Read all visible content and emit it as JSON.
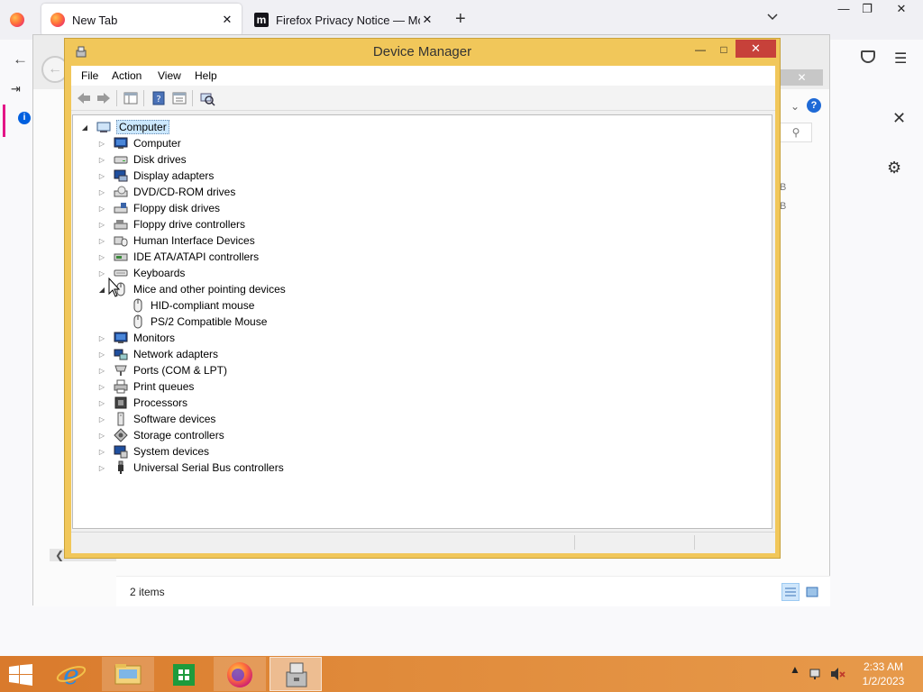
{
  "firefox": {
    "tabs": [
      {
        "label": "New Tab",
        "close": "✕"
      },
      {
        "label": "Firefox Privacy Notice — Mozilla",
        "close": "✕"
      }
    ],
    "new_tab_symbol": "+",
    "window_controls": {
      "minimize": "—",
      "restore": "❐",
      "close": "✕"
    },
    "back_symbol": "←",
    "menu_symbol": "☰",
    "notice_close_symbol": "✕",
    "gear_symbol": "⚙"
  },
  "background_window": {
    "close_symbol": "✕",
    "help_symbol": "?",
    "search_symbol": "⚲",
    "size_fragments": [
      "B",
      "B"
    ],
    "status_text": "2 items",
    "scroll_left_symbol": "❮"
  },
  "device_manager": {
    "title": "Device Manager",
    "window_controls": {
      "minimize": "—",
      "maximize": "□",
      "close": "✕"
    },
    "menu": [
      "File",
      "Action",
      "View",
      "Help"
    ],
    "root": {
      "label": "Computer",
      "expanded": true
    },
    "categories": [
      {
        "label": "Computer",
        "icon": "monitor-icon",
        "expanded": false
      },
      {
        "label": "Disk drives",
        "icon": "disk-drive-icon",
        "expanded": false
      },
      {
        "label": "Display adapters",
        "icon": "display-adapter-icon",
        "expanded": false
      },
      {
        "label": "DVD/CD-ROM drives",
        "icon": "dvd-drive-icon",
        "expanded": false
      },
      {
        "label": "Floppy disk drives",
        "icon": "floppy-drive-icon",
        "expanded": false
      },
      {
        "label": "Floppy drive controllers",
        "icon": "floppy-controller-icon",
        "expanded": false
      },
      {
        "label": "Human Interface Devices",
        "icon": "hid-icon",
        "expanded": false
      },
      {
        "label": "IDE ATA/ATAPI controllers",
        "icon": "ide-controller-icon",
        "expanded": false
      },
      {
        "label": "Keyboards",
        "icon": "keyboard-icon",
        "expanded": false
      },
      {
        "label": "Mice and other pointing devices",
        "icon": "mouse-icon",
        "expanded": true,
        "children": [
          "HID-compliant mouse",
          "PS/2 Compatible Mouse"
        ]
      },
      {
        "label": "Monitors",
        "icon": "monitor-icon",
        "expanded": false
      },
      {
        "label": "Network adapters",
        "icon": "network-adapter-icon",
        "expanded": false
      },
      {
        "label": "Ports (COM & LPT)",
        "icon": "port-icon",
        "expanded": false
      },
      {
        "label": "Print queues",
        "icon": "printer-icon",
        "expanded": false
      },
      {
        "label": "Processors",
        "icon": "processor-icon",
        "expanded": false
      },
      {
        "label": "Software devices",
        "icon": "software-device-icon",
        "expanded": false
      },
      {
        "label": "Storage controllers",
        "icon": "storage-controller-icon",
        "expanded": false
      },
      {
        "label": "System devices",
        "icon": "system-device-icon",
        "expanded": false
      },
      {
        "label": "Universal Serial Bus controllers",
        "icon": "usb-icon",
        "expanded": false
      }
    ],
    "toggle_collapsed": "▷",
    "toggle_expanded": "◢"
  },
  "taskbar": {
    "apps": [
      {
        "name": "Internet Explorer",
        "icon": "internet-explorer-icon",
        "state": "pinned"
      },
      {
        "name": "File Explorer",
        "icon": "file-explorer-icon",
        "state": "running"
      },
      {
        "name": "Store",
        "icon": "store-icon",
        "state": "pinned"
      },
      {
        "name": "Firefox",
        "icon": "firefox-icon",
        "state": "running"
      },
      {
        "name": "Device Manager",
        "icon": "device-manager-icon",
        "state": "active"
      }
    ],
    "tray_arrow": "▲",
    "clock_time": "2:33 AM",
    "clock_date": "1/2/2023"
  },
  "colors": {
    "dm_frame": "#f1c75a",
    "dm_close": "#c7413a",
    "selection": "#cce8ff",
    "taskbar": "#e08a3a",
    "firefox_accent": "#ff7139"
  }
}
